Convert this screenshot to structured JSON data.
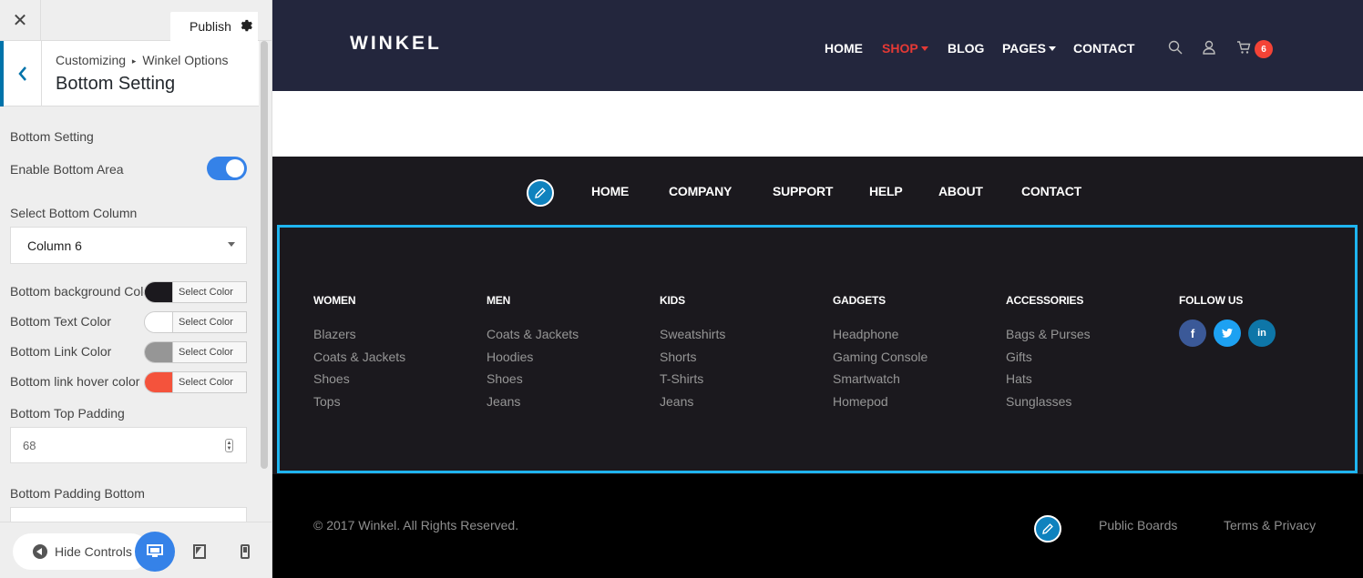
{
  "customizer": {
    "close_label": "✕",
    "publish_label": "Publish",
    "breadcrumb": {
      "root": "Customizing",
      "section": "Winkel Options"
    },
    "panel_title": "Bottom Setting",
    "section_label": "Bottom Setting",
    "enable_bottom": {
      "label": "Enable Bottom Area",
      "value": true
    },
    "select_column": {
      "label": "Select Bottom Column",
      "value": "Column 6"
    },
    "colors": [
      {
        "label": "Bottom background Color",
        "swatch": "#1b191e",
        "button": "Select Color"
      },
      {
        "label": "Bottom Text Color",
        "swatch": "#ffffff",
        "button": "Select Color"
      },
      {
        "label": "Bottom Link Color",
        "swatch": "#969696",
        "button": "Select Color"
      },
      {
        "label": "Bottom link hover color",
        "swatch": "#f4533c",
        "button": "Select Color"
      }
    ],
    "top_padding": {
      "label": "Bottom Top Padding",
      "value": "68"
    },
    "padding_bottom": {
      "label": "Bottom Padding Bottom"
    },
    "hide_controls": "Hide Controls"
  },
  "site": {
    "logo": "WINKEL",
    "nav": [
      {
        "label": "HOME",
        "active": false,
        "dropdown": false
      },
      {
        "label": "SHOP",
        "active": true,
        "dropdown": true
      },
      {
        "label": "BLOG",
        "active": false,
        "dropdown": false
      },
      {
        "label": "PAGES",
        "active": false,
        "dropdown": true
      },
      {
        "label": "CONTACT",
        "active": false,
        "dropdown": false
      }
    ],
    "cart_count": "6",
    "footer_nav": [
      "HOME",
      "COMPANY",
      "SUPPORT",
      "HELP",
      "ABOUT",
      "CONTACT"
    ],
    "columns": [
      {
        "heading": "WOMEN",
        "links": [
          "Blazers",
          "Coats & Jackets",
          "Shoes",
          "Tops"
        ]
      },
      {
        "heading": "MEN",
        "links": [
          "Coats & Jackets",
          "Hoodies",
          "Shoes",
          "Jeans"
        ]
      },
      {
        "heading": "KIDS",
        "links": [
          "Sweatshirts",
          "Shorts",
          "T-Shirts",
          "Jeans"
        ]
      },
      {
        "heading": "GADGETS",
        "links": [
          "Headphone",
          "Gaming Console",
          "Smartwatch",
          "Homepod"
        ]
      },
      {
        "heading": "ACCESSORIES",
        "links": [
          "Bags & Purses",
          "Gifts",
          "Hats",
          "Sunglasses"
        ]
      },
      {
        "heading": "FOLLOW US",
        "links": []
      }
    ],
    "social": [
      {
        "icon": "facebook-icon",
        "glyph": "f",
        "color": "#3b5998"
      },
      {
        "icon": "twitter-icon",
        "glyph": "t",
        "color": "#1da1f2"
      },
      {
        "icon": "linkedin-icon",
        "glyph": "in",
        "color": "#0e76a8"
      }
    ],
    "copyright": "© 2017 Winkel. All Rights Reserved.",
    "bottom_links": [
      "Public Boards",
      "Terms & Privacy"
    ],
    "accent": "#e53935",
    "header_bg": "#23263d",
    "footer_bg": "#1b191e",
    "highlight": "#1fb5f0"
  }
}
